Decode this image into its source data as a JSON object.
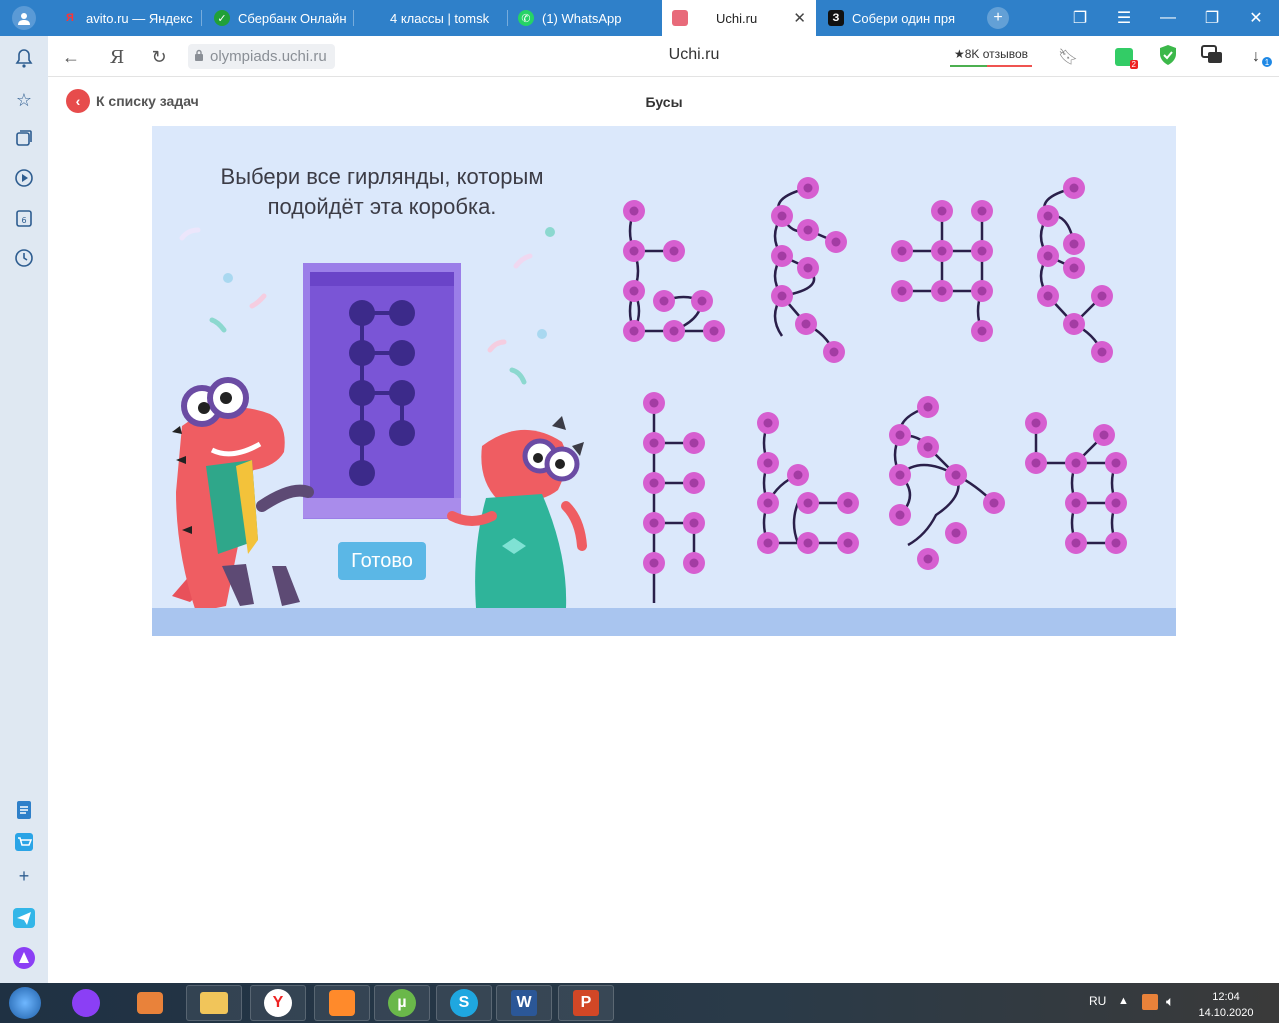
{
  "tabs": [
    {
      "title": "avito.ru — Яндекс",
      "favicon": "yandex-icon",
      "active": false
    },
    {
      "title": "Сбербанк Онлайн",
      "favicon": "sber-icon",
      "active": false
    },
    {
      "title": "4 классы | tomsk",
      "favicon": "",
      "active": false
    },
    {
      "title": "(1) WhatsApp",
      "favicon": "whatsapp-icon",
      "active": false
    },
    {
      "title": "Uchi.ru",
      "favicon": "uchi-icon",
      "active": true
    },
    {
      "title": "Собери один пря",
      "favicon": "zen-icon",
      "active": false
    }
  ],
  "addressbar": {
    "url": "olympiads.uchi.ru",
    "page_title": "Uchi.ru",
    "reviews": "★8K отзывов",
    "yandex_logo": "Я",
    "download_badge": "1",
    "extension_badge": "2"
  },
  "page": {
    "back_label": "К списку задач",
    "task_title": "Бусы",
    "question": "Выбери все гирлянды, которым подойдёт эта коробка.",
    "done_button": "Готово"
  },
  "taskbar": {
    "lang": "RU",
    "time": "12:04",
    "date": "14.10.2020",
    "apps": [
      "start-orb",
      "alice",
      "media-player",
      "file-explorer",
      "yandex-browser",
      "sublime",
      "utorrent",
      "skype",
      "word",
      "powerpoint"
    ]
  },
  "colors": {
    "tabbar": "#2f80c9",
    "stage": "#dbe8fb",
    "bead": "#d65fd0",
    "bead_center": "#a33ca3",
    "box": "#7a55d6",
    "done_button": "#5bb7e6"
  }
}
